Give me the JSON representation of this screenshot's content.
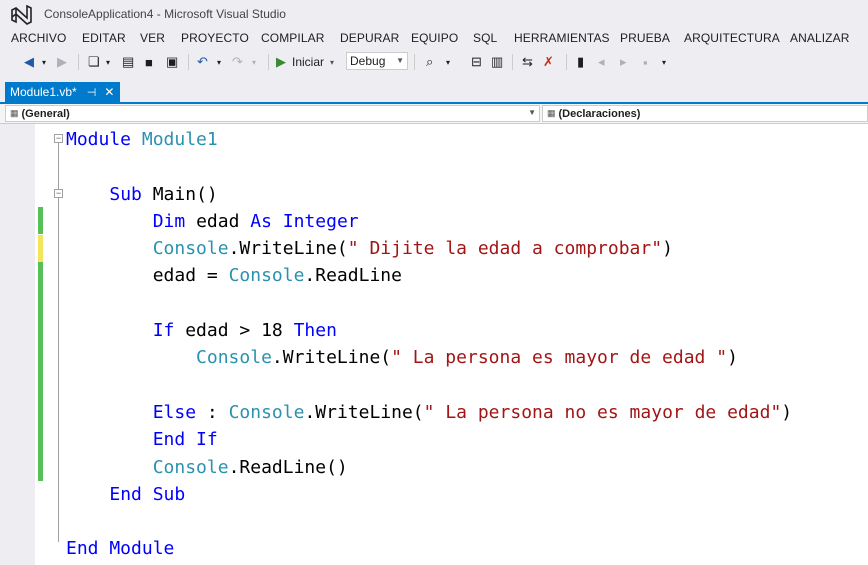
{
  "window": {
    "title": "ConsoleApplication4 - Microsoft Visual Studio"
  },
  "menu": [
    "ARCHIVO",
    "EDITAR",
    "VER",
    "PROYECTO",
    "COMPILAR",
    "DEPURAR",
    "EQUIPO",
    "SQL",
    "HERRAMIENTAS",
    "PRUEBA",
    "ARQUITECTURA",
    "ANALIZAR"
  ],
  "toolbar": {
    "start_label": "Iniciar",
    "config_value": "Debug"
  },
  "tab": {
    "label": "Module1.vb*",
    "pin": "⊣",
    "close": "✕"
  },
  "nav": {
    "left": "(General)",
    "right": "(Declaraciones)"
  },
  "code": [
    [
      [
        "kw",
        "Module "
      ],
      [
        "ty",
        "Module1"
      ]
    ],
    [],
    [
      [
        "",
        "    "
      ],
      [
        "kw",
        "Sub "
      ],
      [
        "",
        "Main()"
      ]
    ],
    [
      [
        "",
        "        "
      ],
      [
        "kw",
        "Dim "
      ],
      [
        "",
        "edad "
      ],
      [
        "kw",
        "As Integer"
      ]
    ],
    [
      [
        "",
        "        "
      ],
      [
        "ty",
        "Console"
      ],
      [
        "",
        ".WriteLine("
      ],
      [
        "st",
        "\" Dijite la edad a comprobar\""
      ],
      [
        "",
        ")"
      ]
    ],
    [
      [
        "",
        "        edad = "
      ],
      [
        "ty",
        "Console"
      ],
      [
        "",
        ".ReadLine"
      ]
    ],
    [],
    [
      [
        "",
        "        "
      ],
      [
        "kw",
        "If "
      ],
      [
        "",
        "edad > 18 "
      ],
      [
        "kw",
        "Then"
      ]
    ],
    [
      [
        "",
        "            "
      ],
      [
        "ty",
        "Console"
      ],
      [
        "",
        ".WriteLine("
      ],
      [
        "st",
        "\" La persona es mayor de edad \""
      ],
      [
        "",
        ")"
      ]
    ],
    [],
    [
      [
        "",
        "        "
      ],
      [
        "kw",
        "Else"
      ],
      [
        "",
        " : "
      ],
      [
        "ty",
        "Console"
      ],
      [
        "",
        ".WriteLine("
      ],
      [
        "st",
        "\" La persona no es mayor de edad\""
      ],
      [
        "",
        ")"
      ]
    ],
    [
      [
        "",
        "        "
      ],
      [
        "kw",
        "End If"
      ]
    ],
    [
      [
        "",
        "        "
      ],
      [
        "ty",
        "Console"
      ],
      [
        "",
        ".ReadLine()"
      ]
    ],
    [
      [
        "",
        "    "
      ],
      [
        "kw",
        "End Sub"
      ]
    ],
    [],
    [
      [
        "kw",
        "End Module"
      ]
    ]
  ],
  "colors": {
    "keyword": "#0000ff",
    "type": "#2b91af",
    "string": "#a31515",
    "accent": "#007acc",
    "saved_change": "#57c157",
    "unsaved_change": "#f2e55b"
  }
}
